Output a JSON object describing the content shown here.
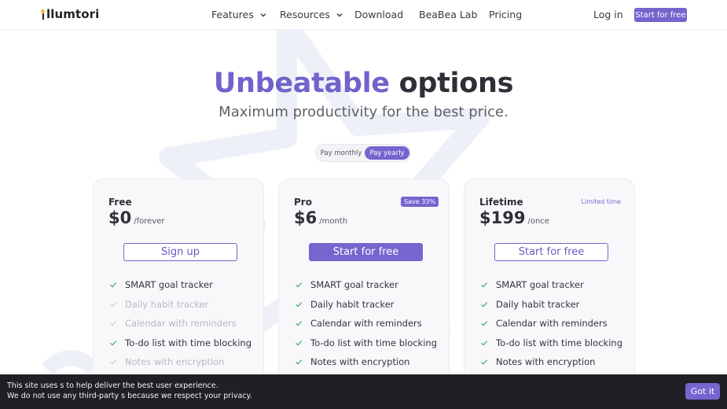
{
  "nav": {
    "logo": "llumtori",
    "items": [
      {
        "label": "Features",
        "dropdown": true
      },
      {
        "label": "Resources",
        "dropdown": true
      },
      {
        "label": "Download",
        "dropdown": false
      },
      {
        "label": "BeaBea Lab",
        "dropdown": false
      },
      {
        "label": "Pricing",
        "dropdown": false
      }
    ],
    "login": "Log in",
    "cta": "Start for free"
  },
  "hero": {
    "title_accent": "Unbeatable",
    "title_rest": "options",
    "subtitle": "Maximum productivity for the best price."
  },
  "billing_toggle": {
    "monthly": "Pay monthly",
    "yearly": "Pay yearly",
    "selected": "yearly"
  },
  "plans": [
    {
      "name": "Free",
      "price": "$0",
      "period": "/forever",
      "badge": "",
      "button": "Sign up",
      "features": [
        {
          "text": "SMART goal tracker",
          "included": true
        },
        {
          "text": "Daily habit tracker",
          "included": false
        },
        {
          "text": "Calendar with reminders",
          "included": false
        },
        {
          "text": "To-do list with time blocking",
          "included": true
        },
        {
          "text": "Notes with encryption",
          "included": false
        }
      ]
    },
    {
      "name": "Pro",
      "price": "$6",
      "period": "/month",
      "badge": "Save 33%",
      "button": "Start for free",
      "features": [
        {
          "text": "SMART goal tracker",
          "included": true
        },
        {
          "text": "Daily habit tracker",
          "included": true
        },
        {
          "text": "Calendar with reminders",
          "included": true
        },
        {
          "text": "To-do list with time blocking",
          "included": true
        },
        {
          "text": "Notes with encryption",
          "included": true
        }
      ]
    },
    {
      "name": "Lifetime",
      "price": "$199",
      "period": "/once",
      "badge": "Limited time",
      "button": "Start for free",
      "features": [
        {
          "text": "SMART goal tracker",
          "included": true
        },
        {
          "text": "Daily habit tracker",
          "included": true
        },
        {
          "text": "Calendar with reminders",
          "included": true
        },
        {
          "text": "To-do list with time blocking",
          "included": true
        },
        {
          "text": "Notes with encryption",
          "included": true
        }
      ]
    }
  ],
  "cookie": {
    "line1": "This site uses   s to help deliver the best user experience.",
    "line2": "We do not use any third-party   s because we respect your privacy.",
    "button": "Got it"
  },
  "colors": {
    "accent": "#7465cf",
    "check": "#4caf7a",
    "cookie_bg": "#202024"
  }
}
